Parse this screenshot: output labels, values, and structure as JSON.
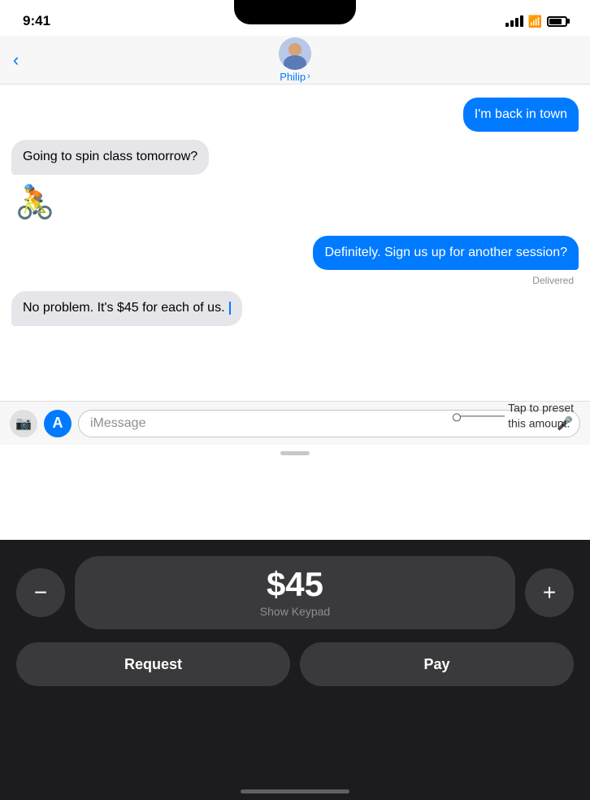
{
  "status": {
    "time": "9:41",
    "battery_level": 80
  },
  "nav": {
    "back_label": "‹",
    "contact_name": "Philip",
    "contact_chevron": "›"
  },
  "messages": [
    {
      "id": 1,
      "type": "sent",
      "text": "I'm back in town"
    },
    {
      "id": 2,
      "type": "received",
      "text": "Going to spin class tomorrow?"
    },
    {
      "id": 3,
      "type": "emoji",
      "text": "🚴"
    },
    {
      "id": 4,
      "type": "sent",
      "text": "Definitely. Sign us up for another session?"
    },
    {
      "id": 5,
      "type": "delivered",
      "text": "Delivered"
    },
    {
      "id": 6,
      "type": "received",
      "text": "No problem. It's $45 for each of us."
    }
  ],
  "input_bar": {
    "placeholder": "iMessage",
    "camera_icon": "📷",
    "appstore_icon": "A"
  },
  "callout": {
    "text": "Tap to preset\nthis amount."
  },
  "payment": {
    "amount": "$45",
    "show_keypad_label": "Show Keypad",
    "minus_label": "−",
    "plus_label": "+",
    "request_label": "Request",
    "pay_label": "Pay"
  }
}
